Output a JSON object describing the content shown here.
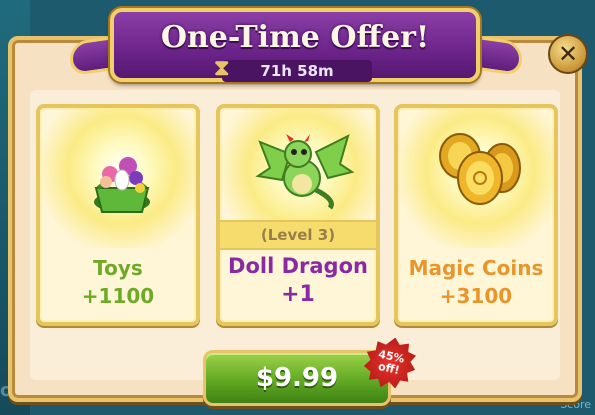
{
  "popup": {
    "title": "One-Time Offer!",
    "timer": "71h 58m",
    "close_icon": "close-icon"
  },
  "background": {
    "left_text": "ollect",
    "right_text": "Score"
  },
  "items": [
    {
      "name": "Toys",
      "amount": "+1100",
      "color": "#6fa928",
      "icon": "toy-basket-icon"
    },
    {
      "level": "(Level 3)",
      "name": "Doll Dragon",
      "amount": "+1",
      "color": "#8a2aa3",
      "icon": "green-dragon-icon"
    },
    {
      "name": "Magic Coins",
      "amount": "+3100",
      "color": "#e8962c",
      "icon": "gold-coins-icon"
    }
  ],
  "purchase": {
    "price": "$9.99",
    "discount_line1": "45%",
    "discount_line2": "off!"
  }
}
